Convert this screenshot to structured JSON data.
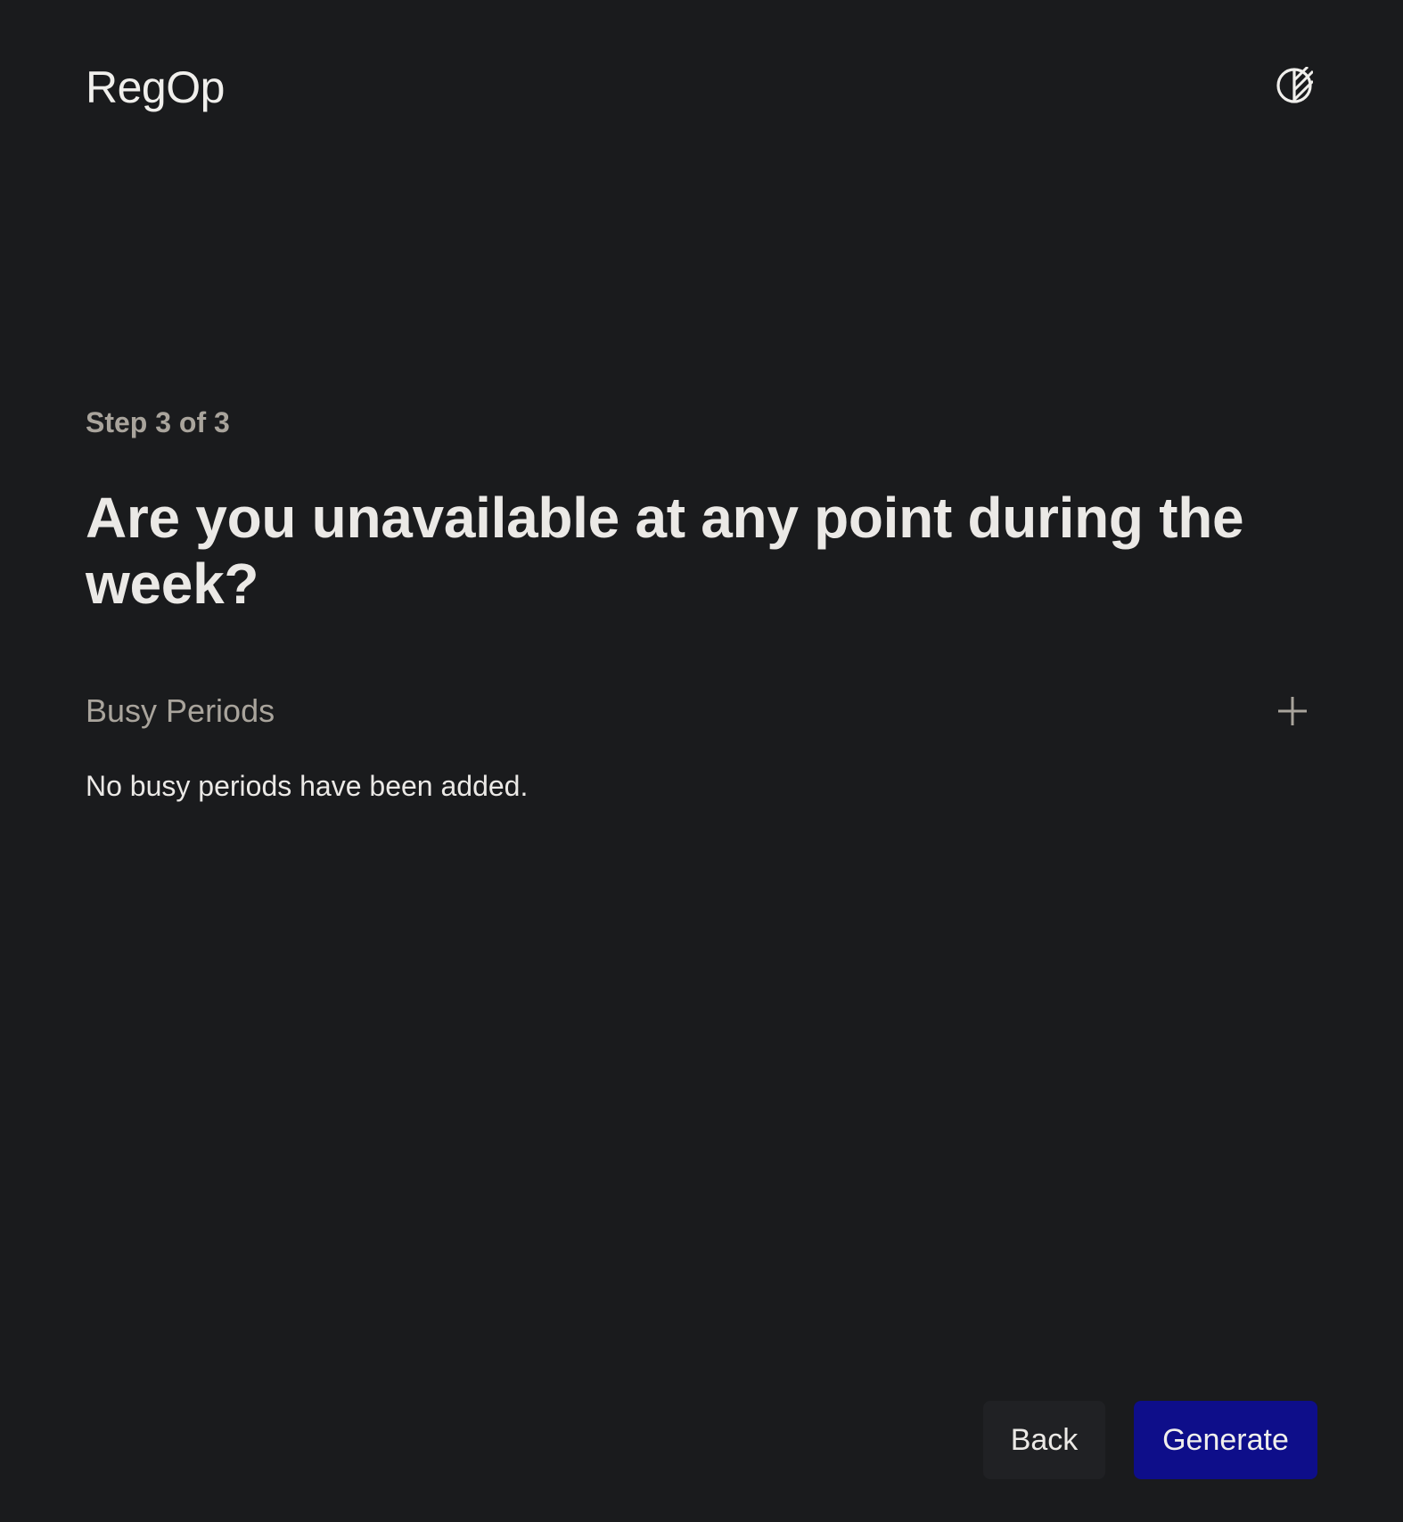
{
  "header": {
    "brand": "RegOp",
    "theme_toggle_icon": "contrast-icon"
  },
  "main": {
    "step_label": "Step 3 of 3",
    "question": "Are you unavailable at any point during the week?",
    "busy_periods": {
      "title": "Busy Periods",
      "add_icon": "plus-icon",
      "empty_message": "No busy periods have been added."
    }
  },
  "footer": {
    "back_label": "Back",
    "generate_label": "Generate"
  },
  "colors": {
    "background": "#1a1b1d",
    "text_primary": "#ebe9e6",
    "text_muted": "#a9a49c",
    "secondary_button": "#202124",
    "primary_button": "#0e0e8a"
  }
}
